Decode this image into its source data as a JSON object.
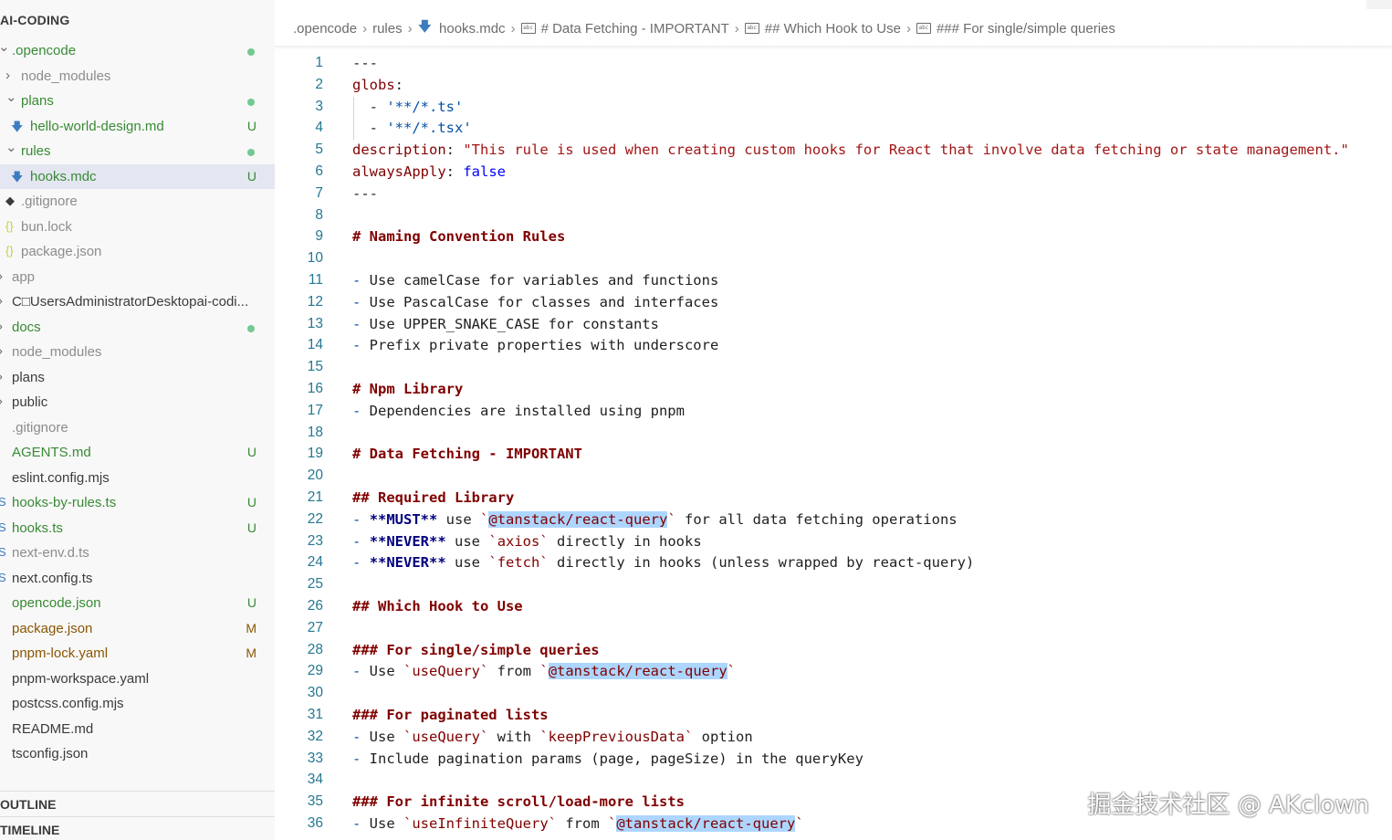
{
  "explorer": {
    "title": "AI-CODING",
    "items": [
      {
        "label": ".opencode",
        "chev": "⌄",
        "status": "dot",
        "color": "green",
        "icon": "",
        "indent": 0
      },
      {
        "label": "node_modules",
        "chev": "›",
        "status": "",
        "color": "gray",
        "icon": "",
        "indent": 1
      },
      {
        "label": "plans",
        "chev": "⌄",
        "status": "dot",
        "color": "green",
        "icon": "",
        "indent": 1
      },
      {
        "label": "hello-world-design.md",
        "chev": "",
        "status": "U",
        "color": "green",
        "icon": "markdown-icon",
        "indent": 2
      },
      {
        "label": "rules",
        "chev": "⌄",
        "status": "dot",
        "color": "green",
        "icon": "",
        "indent": 1
      },
      {
        "label": "hooks.mdc",
        "chev": "",
        "status": "U",
        "color": "green",
        "icon": "markdown-icon",
        "indent": 2,
        "selected": true
      },
      {
        "label": ".gitignore",
        "chev": "",
        "status": "",
        "color": "gray",
        "icon": "git-icon",
        "indent": 1
      },
      {
        "label": "bun.lock",
        "chev": "",
        "status": "",
        "color": "gray",
        "icon": "json-icon",
        "indent": 1
      },
      {
        "label": "package.json",
        "chev": "",
        "status": "",
        "color": "gray",
        "icon": "json-icon",
        "indent": 1
      },
      {
        "label": "app",
        "chev": "›",
        "status": "",
        "color": "gray",
        "icon": "",
        "indent": 0
      },
      {
        "label": "C□UsersAdministratorDesktopai-codi...",
        "chev": "›",
        "status": "",
        "color": "dark",
        "icon": "",
        "indent": 0
      },
      {
        "label": "docs",
        "chev": "›",
        "status": "dot",
        "color": "green",
        "icon": "",
        "indent": 0
      },
      {
        "label": "node_modules",
        "chev": "›",
        "status": "",
        "color": "gray",
        "icon": "",
        "indent": 0
      },
      {
        "label": "plans",
        "chev": "›",
        "status": "",
        "color": "dark",
        "icon": "",
        "indent": 0
      },
      {
        "label": "public",
        "chev": "›",
        "status": "",
        "color": "dark",
        "icon": "",
        "indent": 0
      },
      {
        "label": ".gitignore",
        "chev": "",
        "status": "",
        "color": "gray",
        "icon": "",
        "indent": 0
      },
      {
        "label": "AGENTS.md",
        "chev": "",
        "status": "U",
        "color": "green",
        "icon": "",
        "indent": 0
      },
      {
        "label": "eslint.config.mjs",
        "chev": "",
        "status": "",
        "color": "dark",
        "icon": "",
        "indent": 0
      },
      {
        "label": "hooks-by-rules.ts",
        "chev": "",
        "status": "U",
        "color": "green",
        "icon": "ts-icon",
        "indent": 0
      },
      {
        "label": "hooks.ts",
        "chev": "",
        "status": "U",
        "color": "green",
        "icon": "ts-icon",
        "indent": 0
      },
      {
        "label": "next-env.d.ts",
        "chev": "",
        "status": "",
        "color": "gray",
        "icon": "ts-icon",
        "indent": 0
      },
      {
        "label": "next.config.ts",
        "chev": "",
        "status": "",
        "color": "dark",
        "icon": "ts-icon",
        "indent": 0
      },
      {
        "label": "opencode.json",
        "chev": "",
        "status": "U",
        "color": "green",
        "icon": "",
        "indent": 0
      },
      {
        "label": "package.json",
        "chev": "",
        "status": "M",
        "color": "mod",
        "icon": "",
        "indent": 0
      },
      {
        "label": "pnpm-lock.yaml",
        "chev": "",
        "status": "M",
        "color": "mod",
        "icon": "",
        "indent": 0
      },
      {
        "label": "pnpm-workspace.yaml",
        "chev": "",
        "status": "",
        "color": "dark",
        "icon": "",
        "indent": 0
      },
      {
        "label": "postcss.config.mjs",
        "chev": "",
        "status": "",
        "color": "dark",
        "icon": "",
        "indent": 0
      },
      {
        "label": "README.md",
        "chev": "",
        "status": "",
        "color": "dark",
        "icon": "",
        "indent": 0
      },
      {
        "label": "tsconfig.json",
        "chev": "",
        "status": "",
        "color": "dark",
        "icon": "",
        "indent": 0
      }
    ],
    "outline": "OUTLINE",
    "timeline": "TIMELINE"
  },
  "breadcrumb": [
    {
      "label": ".opencode",
      "icon": ""
    },
    {
      "label": "rules",
      "icon": ""
    },
    {
      "label": "hooks.mdc",
      "icon": "markdown-icon"
    },
    {
      "label": "# Data Fetching - IMPORTANT",
      "icon": "string-symbol-icon"
    },
    {
      "label": "## Which Hook to Use",
      "icon": "string-symbol-icon"
    },
    {
      "label": "### For single/simple queries",
      "icon": "string-symbol-icon"
    }
  ],
  "code_lines": [
    "---",
    "globs:",
    "  - '**/*.ts'",
    "  - '**/*.tsx'",
    "description: \"This rule is used when creating custom hooks for React that involve data fetching or state management.\"",
    "alwaysApply: false",
    "---",
    "",
    "# Naming Convention Rules",
    "",
    "- Use camelCase for variables and functions",
    "- Use PascalCase for classes and interfaces",
    "- Use UPPER_SNAKE_CASE for constants",
    "- Prefix private properties with underscore",
    "",
    "# Npm Library",
    "- Dependencies are installed using pnpm",
    "",
    "# Data Fetching - IMPORTANT",
    "",
    "## Required Library",
    "- **MUST** use `@tanstack/react-query` for all data fetching operations",
    "- **NEVER** use `axios` directly in hooks",
    "- **NEVER** use `fetch` directly in hooks (unless wrapped by react-query)",
    "",
    "## Which Hook to Use",
    "",
    "### For single/simple queries",
    "- Use `useQuery` from `@tanstack/react-query`",
    "",
    "### For paginated lists",
    "- Use `useQuery` with `keepPreviousData` option",
    "- Include pagination params (page, pageSize) in the queryKey",
    "",
    "### For infinite scroll/load-more lists",
    "- Use `useInfiniteQuery` from `@tanstack/react-query`"
  ],
  "watermark": "掘金技术社区 @ AKclown",
  "colors": {
    "green": "#388a34",
    "modified": "#895503",
    "dot": "#73c991",
    "selection": "#e4e6f1",
    "highlight": "#add6ff",
    "line_number": "#237893"
  }
}
